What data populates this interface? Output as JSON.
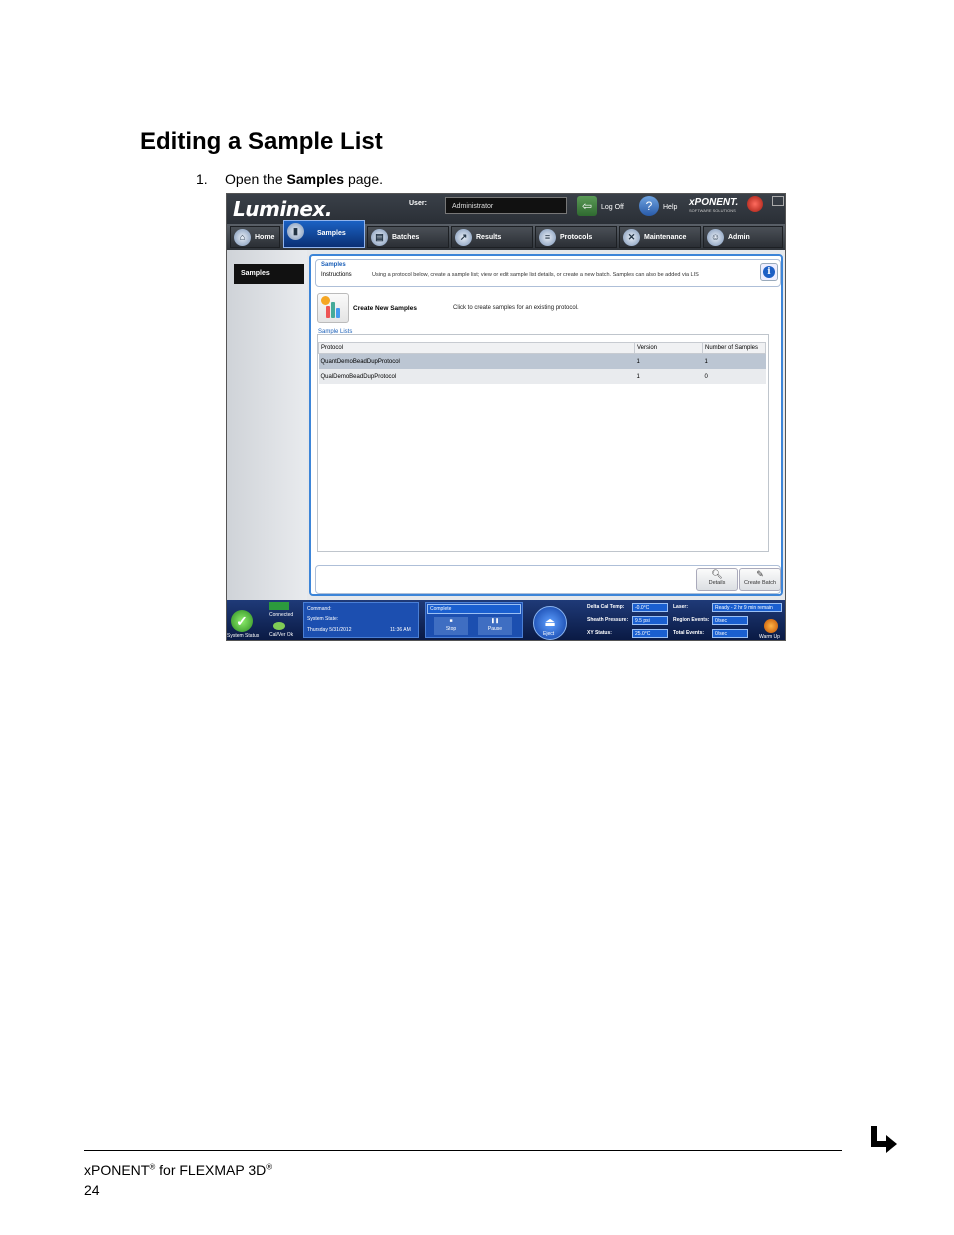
{
  "document": {
    "title": "Editing a Sample List",
    "step_number": "1.",
    "step_prefix": "Open the",
    "step_bold": "Samples",
    "step_suffix": "page."
  },
  "app": {
    "logo": "Luminex.",
    "user_label": "User:",
    "user_value": "Administrator",
    "logoff_label": "Log Off",
    "help_label": "Help",
    "brand": "xPONENT.",
    "brand_sub": "SOFTWARE SOLUTIONS",
    "tabs": [
      {
        "label": "Home",
        "icon": "home-icon"
      },
      {
        "label": "Samples",
        "icon": "samples-icon"
      },
      {
        "label": "Batches",
        "icon": "batches-icon"
      },
      {
        "label": "Results",
        "icon": "results-icon"
      },
      {
        "label": "Protocols",
        "icon": "protocols-icon"
      },
      {
        "label": "Maintenance",
        "icon": "maintenance-icon"
      },
      {
        "label": "Admin",
        "icon": "admin-icon"
      }
    ],
    "active_tab": "Samples",
    "sidebar_item": "Samples",
    "instructions_title": "Samples",
    "instructions_label": "Instructions",
    "instructions_text": "Using a protocol below, create a sample list; view or edit sample list details, or create a new batch. Samples can also be added via LIS",
    "create_label": "Create New Samples",
    "create_desc": "Click to create samples for an existing protocol.",
    "sample_lists_title": "Sample Lists",
    "table": {
      "headers": [
        "Protocol",
        "Version",
        "Number of Samples"
      ],
      "rows": [
        [
          "QuantDemoBeadDupProtocol",
          "1",
          "1"
        ],
        [
          "QualDemoBeadDupProtocol",
          "1",
          "0"
        ]
      ]
    },
    "details_label": "Details",
    "create_batch_label": "Create Batch",
    "status": {
      "system_status": "System Status",
      "connected": "Connected",
      "calver": "Cal/Ver Ok",
      "command_label": "Command:",
      "system_state_label": "System State:",
      "date": "Thursday 5/31/2012",
      "time": "11:36 AM",
      "complete": "Complete",
      "stop": "Stop",
      "pause": "Pause",
      "eject": "Eject",
      "delta_cal_temp_label": "Delta Cal Temp:",
      "delta_cal_temp": "-0.0°C",
      "sheath_pressure_label": "Sheath Pressure:",
      "sheath_pressure": "9.5 psi",
      "xy_status_label": "XY Status:",
      "xy_status": "25.0°C",
      "laser_label": "Laser:",
      "laser_value": "Ready - 2 hr 9 min remain",
      "region_events_label": "Region Events:",
      "region_events": "0/sec",
      "total_events_label": "Total Events:",
      "total_events": "0/sec",
      "warmup": "Warm Up"
    }
  },
  "footer": {
    "product": "xPONENT",
    "reg": "®",
    "for_text": " for FLEXMAP 3D",
    "reg2": "®",
    "page": "24"
  }
}
